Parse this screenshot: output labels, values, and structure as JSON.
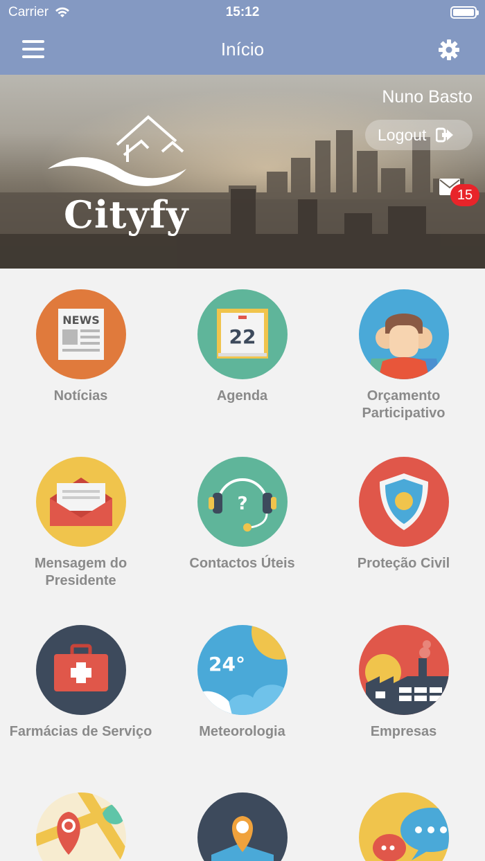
{
  "status_bar": {
    "carrier": "Carrier",
    "time": "15:12"
  },
  "nav": {
    "title": "Início",
    "menu_icon": "hamburger-icon",
    "settings_icon": "gear-icon"
  },
  "hero": {
    "user_name": "Nuno Basto",
    "logout_label": "Logout",
    "mail_badge": "15",
    "logo_text": "Cityfy"
  },
  "tiles": [
    {
      "label": "Notícias",
      "icon": "newspaper-icon",
      "color": "#e07a3c"
    },
    {
      "label": "Agenda",
      "icon": "calendar-icon",
      "color": "#5fb59a",
      "calendar_day": "22"
    },
    {
      "label": "Orçamento Participativo",
      "icon": "people-icon",
      "color": "#4aa9d8"
    },
    {
      "label": "Mensagem do Presidente",
      "icon": "envelope-icon",
      "color": "#f0c44c"
    },
    {
      "label": "Contactos Úteis",
      "icon": "headset-icon",
      "color": "#5fb59a",
      "symbol": "?"
    },
    {
      "label": "Proteção Civil",
      "icon": "shield-icon",
      "color": "#e0574a"
    },
    {
      "label": "Farmácias de Serviço",
      "icon": "first-aid-kit-icon",
      "color": "#3d4a5c"
    },
    {
      "label": "Meteorologia",
      "icon": "weather-icon",
      "color": "#4aa9d8",
      "temperature": "24°"
    },
    {
      "label": "Empresas",
      "icon": "factory-icon",
      "color": "#e0574a"
    },
    {
      "label": "",
      "icon": "map-icon",
      "color": "#f7ecd0"
    },
    {
      "label": "",
      "icon": "location-pin-icon",
      "color": "#3d4a5c"
    },
    {
      "label": "",
      "icon": "chat-bubbles-icon",
      "color": "#f0c44c"
    }
  ]
}
